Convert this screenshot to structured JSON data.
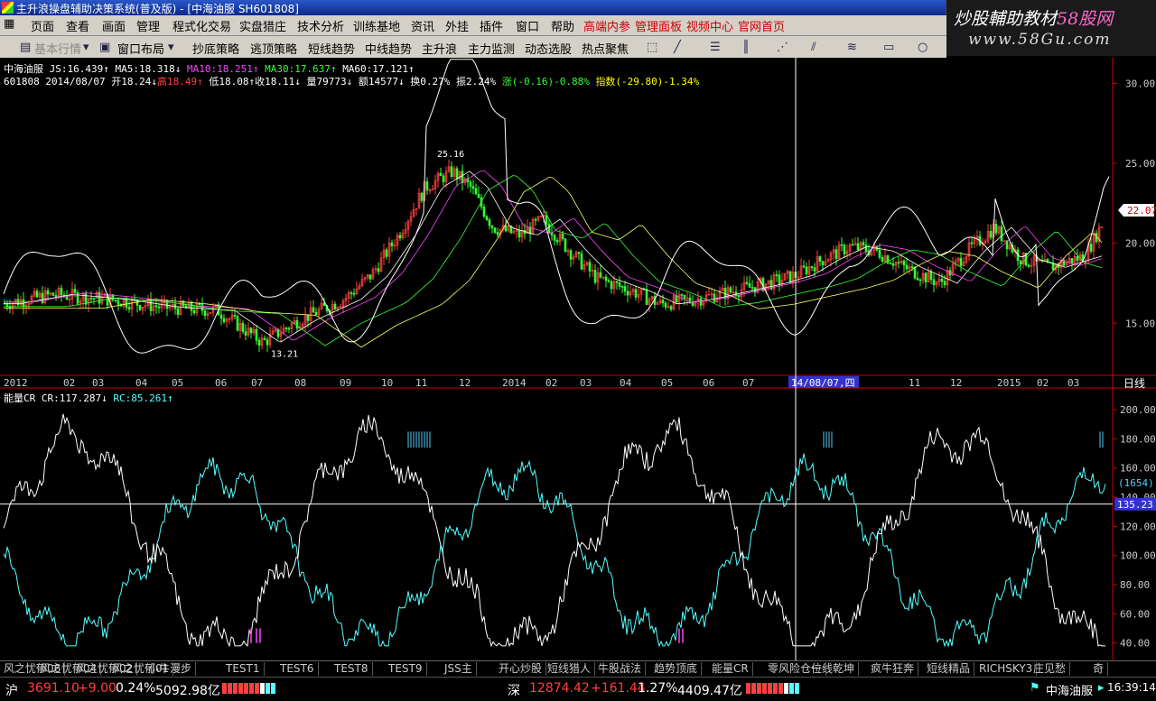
{
  "window": {
    "title": "主升浪操盘辅助决策系统(普及版) - [中海油服 SH601808]"
  },
  "watermark": {
    "line1a": "炒股輔助教材",
    "line1b": "58股网",
    "line2": "www.58Gu.com"
  },
  "menu": {
    "items": [
      "页面",
      "查看",
      "画面",
      "管理",
      "程式化交易",
      "实盘猎庄",
      "技术分析",
      "训练基地",
      "资讯",
      "外挂",
      "插件",
      "窗口",
      "帮助"
    ],
    "red_items": [
      "高端内参",
      "管理面板",
      "视频中心",
      "官网首页"
    ]
  },
  "toolbar": {
    "basic": "基本行情",
    "layout": "窗口布局",
    "buttons": [
      "抄底策略",
      "逃顶策略",
      "短线趋势",
      "中线趋势",
      "主升浪",
      "主力监测",
      "动态选股",
      "热点聚焦"
    ]
  },
  "quote": {
    "line1": {
      "name": "中海油服",
      "js": "JS:16.439↑",
      "ma5": "MA5:18.318↓",
      "ma10": "MA10:18.251↑",
      "ma30": "MA30:17.637↑",
      "ma60": "MA60:17.121↑"
    },
    "line2": {
      "code_date": "601808 2014/08/07",
      "open": "开18.24↓",
      "high": "高18.49↑",
      "low": "低18.08↑",
      "close": "收18.11↓",
      "vol": "量79773↓",
      "amt": "额14577↓",
      "turn": "换0.27%",
      "amp": "振2.24%",
      "chg": "涨(-0.16)-0.88%",
      "idx": "指数(-29.80)-1.34%"
    }
  },
  "price_axis": {
    "ticks": [
      "30.00",
      "25.00",
      "20.00",
      "15.00"
    ],
    "values": [
      30,
      25,
      20,
      15
    ],
    "current": "22.07",
    "current_value": 22.07,
    "min": 11.8,
    "max": 31.6
  },
  "labels": {
    "high": "25.16",
    "low": "13.21",
    "cursor_date": "14/08/07,四",
    "period": "日线"
  },
  "time_axis": [
    "2012",
    "02",
    "03",
    "04",
    "05",
    "06",
    "07",
    "08",
    "09",
    "10",
    "11",
    "12",
    "2014",
    "02",
    "03",
    "04",
    "05",
    "06",
    "07",
    "10",
    "11",
    "12",
    "2015",
    "02",
    "03"
  ],
  "cr": {
    "title": "能量CR",
    "cr": "CR:117.287↓",
    "rc": "RC:85.261↑",
    "ticks": [
      "200.00",
      "180.00",
      "160.00",
      "140.00",
      "120.00",
      "100.00",
      "80.00",
      "60.00",
      "40.00"
    ],
    "tick_values": [
      200,
      180,
      160,
      140,
      120,
      100,
      80,
      60,
      40
    ],
    "marker": "(1654)",
    "cursor_value": "135.23",
    "cursor_num": 135.23
  },
  "tabs": [
    "风之忧郁06",
    "风之忧郁04",
    "风之忧郁02",
    "风之忧郁01",
    "小牛漫步",
    "TEST1",
    "TEST6",
    "TEST8",
    "TEST9",
    "JSS主",
    "开心炒股",
    "短线猎人",
    "牛股战法",
    "趋势顶底",
    "能量CR",
    "零风险仓位",
    "一线乾坤",
    "疯牛狂奔",
    "短线精品",
    "RICHSKY3",
    "庄见愁",
    "奇"
  ],
  "status": {
    "sh_label": "沪",
    "sh_index": "3691.10",
    "sh_chg": "+9.00",
    "sh_pct": "0.24%",
    "sh_amt": "5092.98亿",
    "sz_label": "深",
    "sz_index": "12874.42",
    "sz_chg": "+161.44",
    "sz_pct": "1.27%",
    "sz_amt": "4409.47亿",
    "stock": "中海油服",
    "time": "16:39:14"
  },
  "colors": {
    "up": "#ff4040",
    "down": "#33ff33",
    "ma10": "#ff44ff",
    "ma30": "#33ff33",
    "rc": "#55ffff",
    "menu_red": "#cc0000"
  }
}
